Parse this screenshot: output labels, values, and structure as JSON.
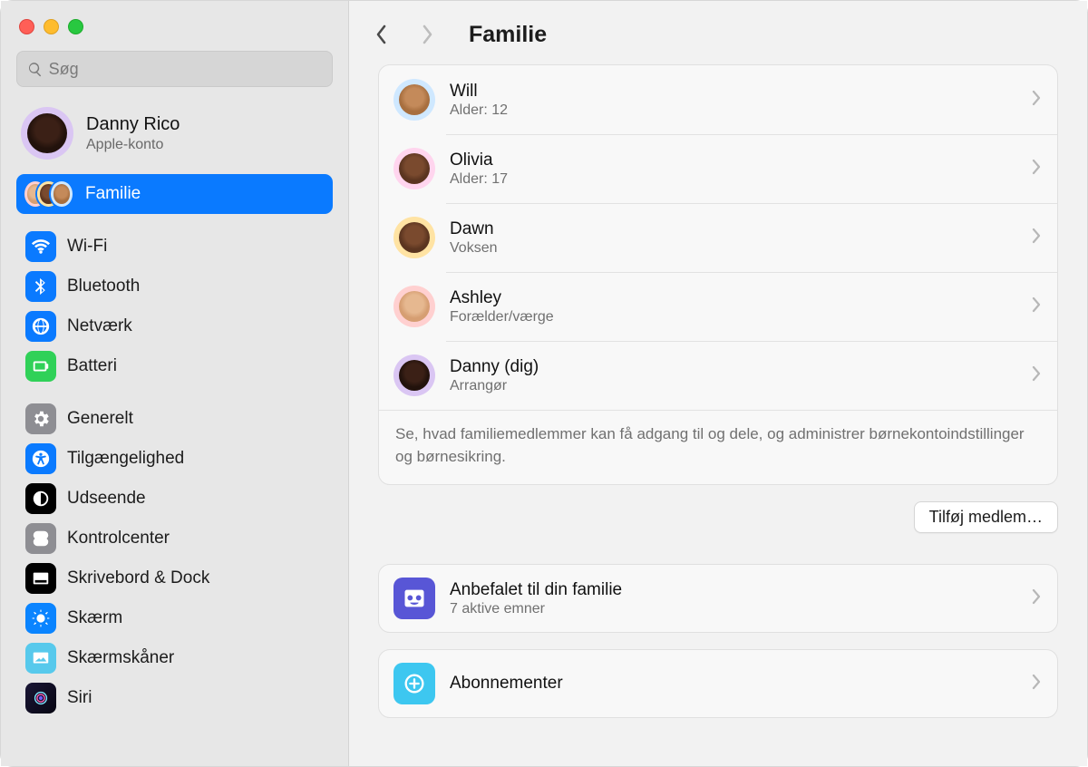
{
  "window": {
    "title": "Familie"
  },
  "search": {
    "placeholder": "Søg"
  },
  "account": {
    "name": "Danny Rico",
    "subtitle": "Apple-konto"
  },
  "sidebar": {
    "items": [
      {
        "id": "familie",
        "label": "Familie",
        "icon": "family-stack",
        "selected": true
      },
      {
        "id": "wifi",
        "label": "Wi-Fi",
        "icon": "wifi"
      },
      {
        "id": "bluetooth",
        "label": "Bluetooth",
        "icon": "bluetooth"
      },
      {
        "id": "network",
        "label": "Netværk",
        "icon": "globe"
      },
      {
        "id": "battery",
        "label": "Batteri",
        "icon": "battery"
      },
      {
        "id": "general",
        "label": "Generelt",
        "icon": "gear"
      },
      {
        "id": "accessibility",
        "label": "Tilgængelighed",
        "icon": "accessibility"
      },
      {
        "id": "appearance",
        "label": "Udseende",
        "icon": "appearance"
      },
      {
        "id": "control-center",
        "label": "Kontrolcenter",
        "icon": "switches"
      },
      {
        "id": "desktop-dock",
        "label": "Skrivebord & Dock",
        "icon": "dock"
      },
      {
        "id": "display",
        "label": "Skærm",
        "icon": "sun"
      },
      {
        "id": "screensaver",
        "label": "Skærmskåner",
        "icon": "screensaver"
      },
      {
        "id": "siri",
        "label": "Siri",
        "icon": "siri"
      }
    ]
  },
  "family": {
    "members": [
      {
        "name": "Will",
        "subtitle": "Alder: 12",
        "avatar": "boy",
        "ring": "boy"
      },
      {
        "name": "Olivia",
        "subtitle": "Alder: 17",
        "avatar": "girl",
        "ring": "girl"
      },
      {
        "name": "Dawn",
        "subtitle": "Voksen",
        "avatar": "dawn",
        "ring": "dawn"
      },
      {
        "name": "Ashley",
        "subtitle": "Forælder/værge",
        "avatar": "ash",
        "ring": "ash"
      },
      {
        "name": "Danny (dig)",
        "subtitle": "Arrangør",
        "avatar": "danny",
        "ring": "danny"
      }
    ],
    "footer_text": "Se, hvad familiemedlemmer kan få adgang til og dele, og administrer børnekontoindstillinger og børnesikring.",
    "add_button": "Tilføj medlem…"
  },
  "sections": {
    "recommend": {
      "title": "Anbefalet til din familie",
      "subtitle": "7 aktive emner"
    },
    "subscriptions": {
      "title": "Abonnementer"
    }
  }
}
